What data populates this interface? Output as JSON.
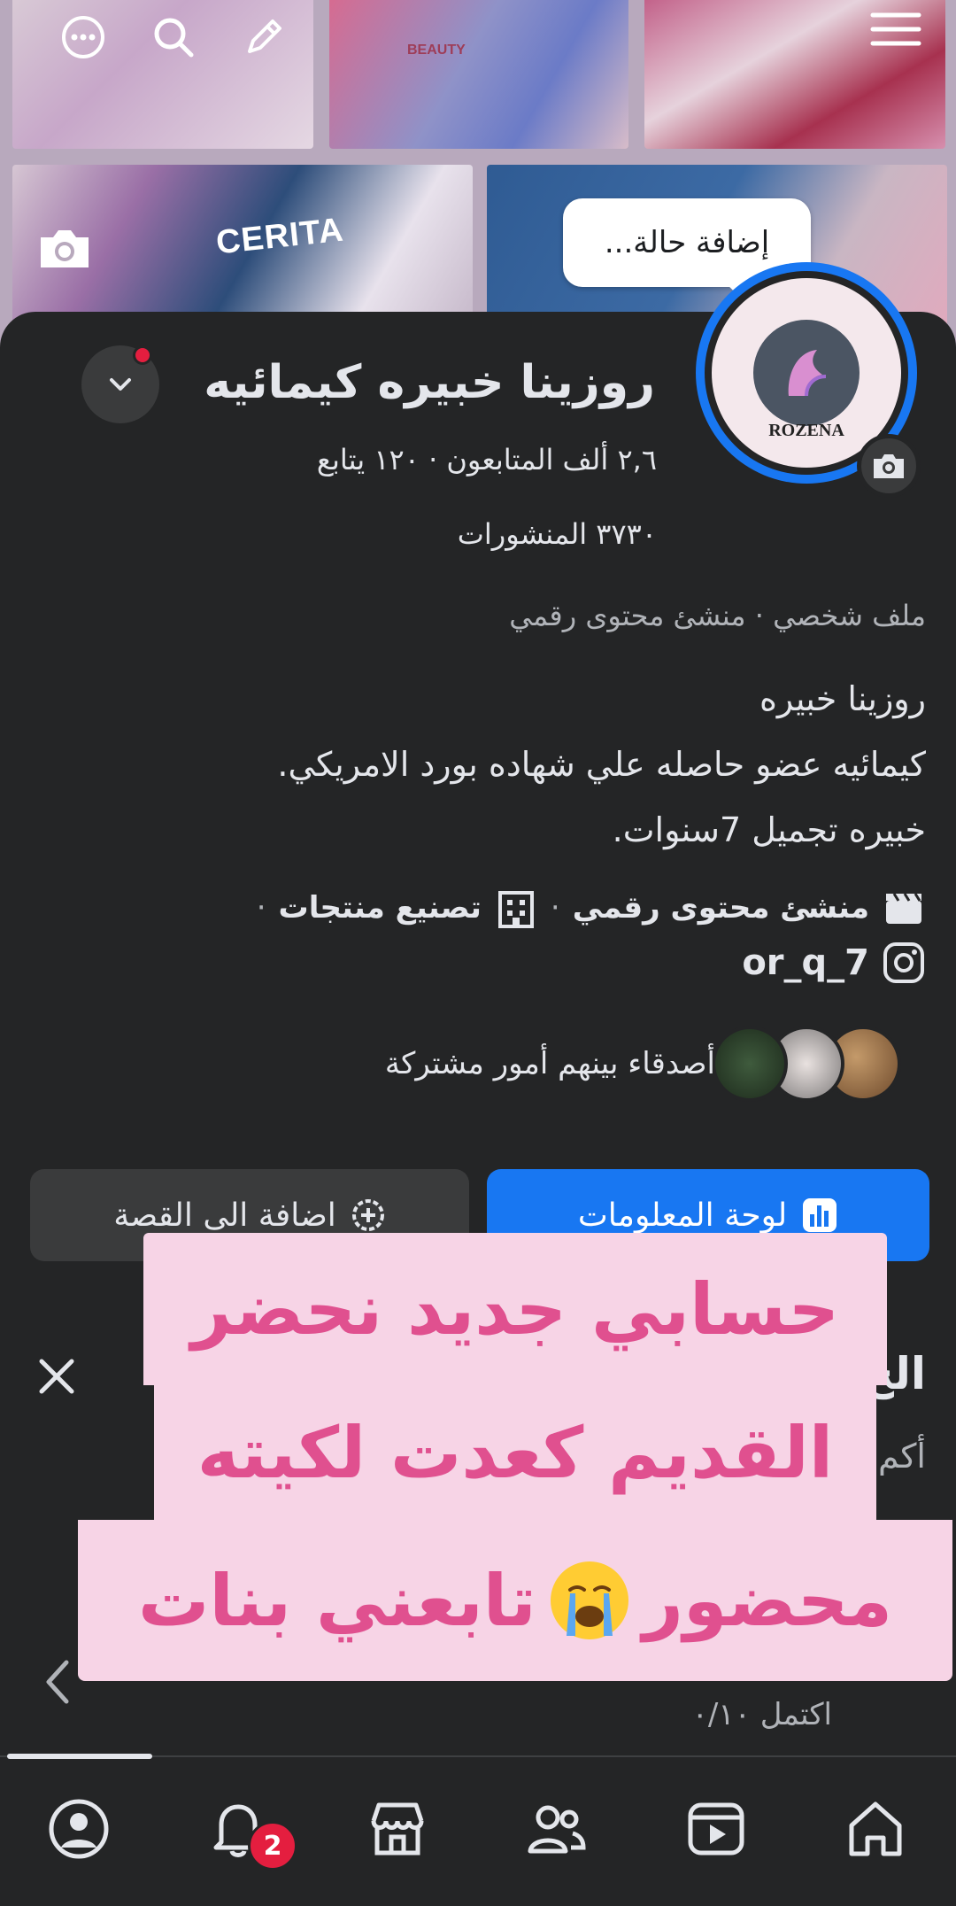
{
  "cover": {
    "labels": {
      "beauty": "BEAUTY",
      "brand": "CERITA"
    }
  },
  "status_bubble": {
    "placeholder": "إضافة حالة..."
  },
  "profile": {
    "name": "روزينا خبيره كيمائيه",
    "avatar_brand": "ROZENA",
    "followers_line": "٢,٦ ألف المتابعون · ١٢٠ يتابع",
    "posts_line": "٣٧٣٠ المنشورات",
    "type_line": "ملف شخصي · منشئ محتوى رقمي",
    "bio": [
      "روزينا  خبيره",
      "كيمائيه  عضو حاصله علي شهاده بورد الامريكي.",
      "خبيره تجميل 7سنوات."
    ],
    "details": {
      "category_1": "منشئ محتوى رقمي",
      "category_2": "تصنيع منتجات",
      "instagram": "or_q_7"
    },
    "mutual_friends": "أصدقاء بينهم أمور مشتركة"
  },
  "buttons": {
    "dashboard": "لوحة المعلومات",
    "add_story": "اضافة الى القصة"
  },
  "section": {
    "title": "الخ",
    "subtitle": "أكم",
    "progress": "اكتمل ٠/١٠"
  },
  "overlay_caption": {
    "line1": "حسابي جديد  نحضر",
    "line2": "القديم   كعدت لكيته",
    "line3a": "محضور",
    "line3b": "تابعني بنات"
  },
  "nav": {
    "notifications_badge": "2",
    "active_tab": "profile"
  },
  "colors": {
    "accent_blue": "#1877f2",
    "background": "#242526",
    "caption_bg": "#f7d4e6",
    "caption_text": "#e0508f",
    "badge_red": "#e41e3f"
  }
}
